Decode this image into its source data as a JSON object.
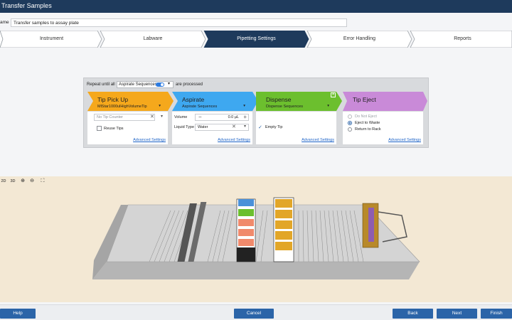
{
  "window": {
    "title": "Transfer Samples"
  },
  "name_field": {
    "label": "ame",
    "value": "Transfer samples to assay plate"
  },
  "steps": [
    {
      "label": "Instrument",
      "active": false
    },
    {
      "label": "Labware",
      "active": false
    },
    {
      "label": "Pipetting Settings",
      "active": true
    },
    {
      "label": "Error Handling",
      "active": false
    },
    {
      "label": "Reports",
      "active": false
    }
  ],
  "repeat": {
    "prefix": "Repeat until all",
    "selected": "Aspirate Sequences",
    "suffix": "are processed"
  },
  "cards": {
    "tip_pickup": {
      "title": "Tip Pick Up",
      "subtitle": "MlStar1000ulHighVolumeTip",
      "counter_placeholder": "No Tip Counter",
      "reuse_tips": "Reuse Tips",
      "advanced": "Advanced Settings",
      "color": "#f5a81c"
    },
    "aspirate": {
      "title": "Aspirate",
      "subtitle": "Aspirate Sequences",
      "volume_label": "Volume",
      "volume_value": "0.0 µL",
      "liquid_type_label": "Liquid Type",
      "liquid_type_value": "Water",
      "advanced": "Advanced Settings",
      "color": "#3ea8f0"
    },
    "dispense": {
      "title": "Dispense",
      "subtitle": "Dispense Sequences",
      "empty_tip": "Empty Tip",
      "empty_tip_checked": true,
      "advanced": "Advanced Settings",
      "color": "#6cbf2e"
    },
    "tip_eject": {
      "title": "Tip Eject",
      "options": [
        "Do Not Eject",
        "Eject to Waste",
        "Return to Rack"
      ],
      "selected_option": "Eject to Waste",
      "advanced": "Advanced Settings",
      "color": "#c98ad8"
    }
  },
  "view_controls": [
    "2D",
    "3D",
    "zoom-in-icon",
    "zoom-out-icon",
    "fullscreen-icon"
  ],
  "footer": {
    "help": "Help",
    "cancel": "Cancel",
    "back": "Back",
    "next": "Next",
    "finish": "Finish"
  },
  "colors": {
    "titlebar": "#1e3a5c",
    "active_step": "#1e3a5c",
    "button": "#2b64a8",
    "viewport_bg": "#f3e8d4"
  }
}
